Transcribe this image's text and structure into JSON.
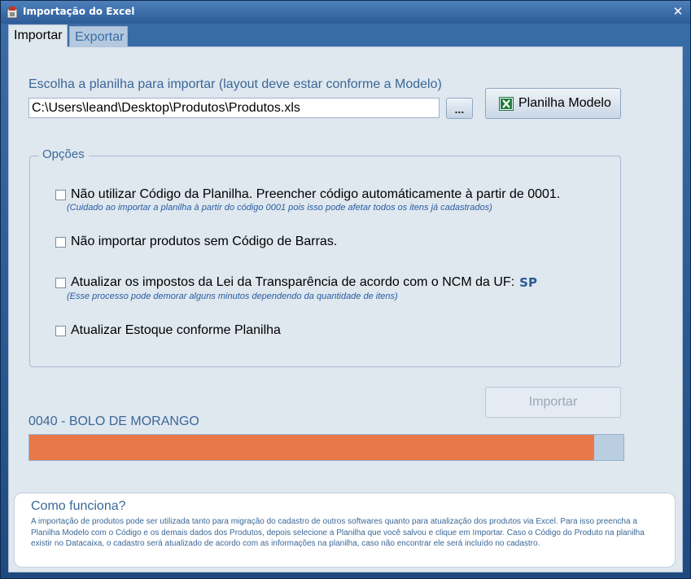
{
  "window": {
    "title": "Importação do Excel",
    "close_symbol": "✕"
  },
  "tabs": [
    {
      "label": "Importar",
      "active": true
    },
    {
      "label": "Exportar",
      "active": false
    }
  ],
  "import": {
    "choose_label": "Escolha a planilha para importar (layout deve estar conforme a Modelo)",
    "file_path": "C:\\Users\\leand\\Desktop\\Produtos\\Produtos.xls",
    "browse_label": "...",
    "model_button_label": "Planilha Modelo",
    "model_button_icon": "excel-icon"
  },
  "options": {
    "legend": "Opções",
    "items": [
      {
        "label": "Não utilizar Código da Planilha. Preencher código automáticamente à partir de 0001.",
        "checked": false,
        "note": "(Cuidado ao importar a planilha à partir do código 0001 pois isso pode afetar todos os itens já cadastrados)"
      },
      {
        "label": "Não importar produtos sem Código de Barras.",
        "checked": false
      },
      {
        "label": "Atualizar os impostos da Lei da Transparência de acordo com o NCM da UF:",
        "checked": false,
        "uf": "SP",
        "note": "(Esse processo pode demorar alguns minutos dependendo da quantidade de itens)"
      },
      {
        "label": "Atualizar Estoque conforme Planilha",
        "checked": false
      }
    ]
  },
  "import_button_label": "Importar",
  "status": {
    "current_item": "0040 - BOLO DE MORANGO",
    "progress_percent": 95
  },
  "howto": {
    "title": "Como funciona?",
    "text": "A importação de produtos pode ser utilizada tanto para migração do cadastro de outros softwares quanto para atualização dos produtos via Excel. Para isso preencha a Planilha Modelo com o Código e os demais dados dos Produtos, depois selecione a Planilha que você salvou e clique em Importar. Caso o Código do Produto na planilha existir no Datacaixa, o cadastro será atualizado de acordo com as informações na planilha, caso não encontrar ele será incluído no cadastro."
  },
  "colors": {
    "progress_fill": "#e87847",
    "accent_text": "#3b6898"
  }
}
